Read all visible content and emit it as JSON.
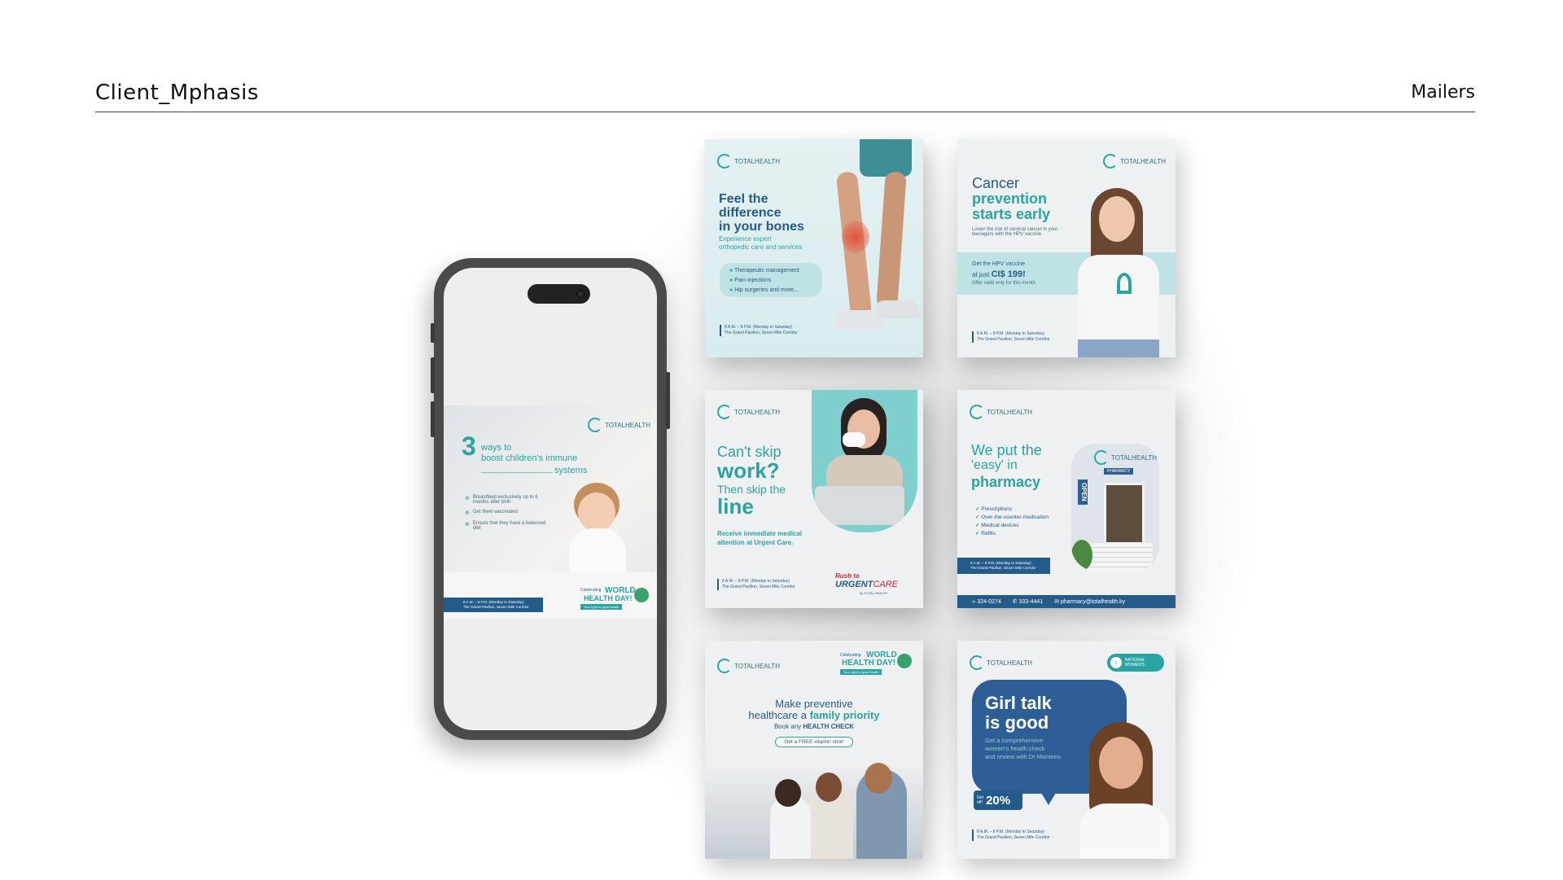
{
  "header": {
    "title": "Client_Mphasis",
    "section": "Mailers"
  },
  "logo_text": "TOTALHEALTH",
  "footer_hours": "8 A.M. – 8 P.M. (Monday to Saturday)",
  "footer_address": "The Grand Pavilion, Seven Mile Corridor",
  "phone_card": {
    "number": "3",
    "line1": "ways to",
    "line2": "boost children's immune",
    "line3": "systems",
    "bullets": [
      "Breastfeed exclusively up to 6 months after birth",
      "Get them vaccinated",
      "Ensure that they have a balanced diet"
    ],
    "badge_line1": "Celebrating",
    "badge_world": "WORLD",
    "badge_health": "HEALTH DAY!",
    "badge_tag": "Your right to good health"
  },
  "card_bones": {
    "title1": "Feel the",
    "title2": "difference",
    "title3": "in your bones",
    "sub1": "Experience expert",
    "sub2": "orthopedic care and services",
    "bullets": [
      "Therapeutic management",
      "Pain injections",
      "Hip surgeries and more..."
    ]
  },
  "card_cancer": {
    "title1": "Cancer",
    "title2": "prevention",
    "title3": "starts early",
    "desc": "Lower the risk of cervical cancer in your teenagers with the HPV vaccine",
    "offer1": "Get the HPV vaccine",
    "offer2": "at just",
    "price": "CI$ 199!",
    "offer3": "Offer valid only for this month"
  },
  "card_work": {
    "line1": "Can't skip",
    "line2": "work?",
    "line3": "Then skip the",
    "line4": "line",
    "cta1": "Receive immediate medical",
    "cta2": "attention at Urgent Care.",
    "brand_top": "Rush to",
    "brand_main": "URGENT",
    "brand_main2": "CARE",
    "brand_by": "by TOTAL HEALTH"
  },
  "card_pharmacy": {
    "line1": "We put the",
    "line2": "'easy' in",
    "line3": "pharmacy",
    "bullets": [
      "Prescriptions",
      "Over-the-counter-medication",
      "Medical devices",
      "Refills"
    ],
    "phone1": "324-0274",
    "phone2": "333-4441",
    "email": "pharmacy@totalhealth.ky",
    "sign_open": "OPEN",
    "sign_pharmacy": "PHARMACY"
  },
  "card_family": {
    "badge_line1": "Celebrating",
    "badge_world": "WORLD",
    "badge_health": "HEALTH DAY!",
    "badge_tag": "Your right to good health",
    "line1": "Make preventive",
    "line2a": "healthcare a ",
    "line2b": "family priority",
    "line3a": "Book any ",
    "line3b": "HEALTH CHECK",
    "pill": "Get a FREE vitamin shot!"
  },
  "card_girl": {
    "badge": "NATIONAL WOMEN'S",
    "title1": "Girl talk",
    "title2": "is good",
    "sub1": "Get a comprehensive",
    "sub2": "women's health check",
    "sub3": "and review with Dr Monteiro",
    "off_label": "Get",
    "off_label2": "off!",
    "off": "20%"
  },
  "colors": {
    "teal": "#2aa3a3",
    "navy": "#235b8a",
    "mint": "#bfe3e4"
  }
}
